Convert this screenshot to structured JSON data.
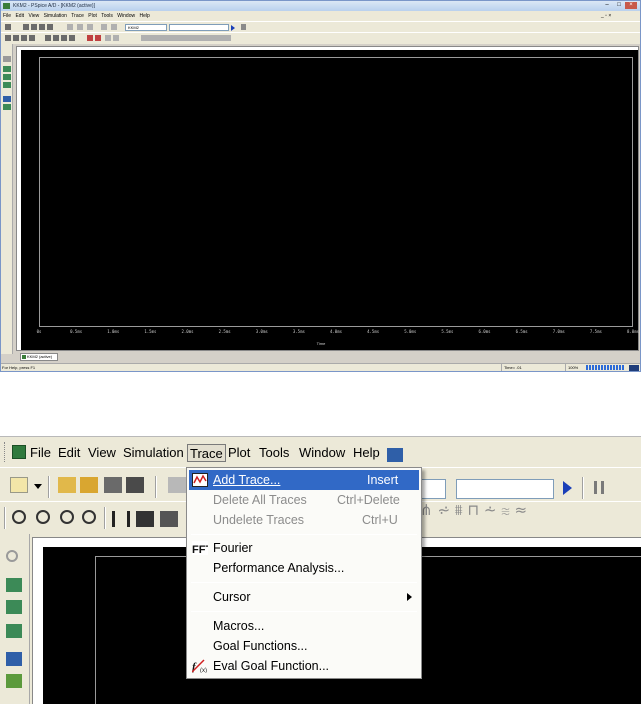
{
  "window": {
    "title": "KKM2 - PSpice A/D - [KKM2 (active)]",
    "menu": [
      "File",
      "Edit",
      "View",
      "Simulation",
      "Trace",
      "Plot",
      "Tools",
      "Window",
      "Help"
    ],
    "profile_box": "KKM2",
    "doc_tab": "KKM2 (active)",
    "status_help": "For Help, press F1",
    "status_time": "Time= .01",
    "status_percent": "100%"
  },
  "plot": {
    "x_ticks": [
      "0s",
      "0.5ms",
      "1.0ms",
      "1.5ms",
      "2.0ms",
      "2.5ms",
      "3.0ms",
      "3.5ms",
      "4.0ms",
      "4.5ms",
      "5.0ms",
      "5.5ms",
      "6.0ms",
      "6.5ms",
      "7.0ms",
      "7.5ms",
      "8.0ms"
    ],
    "x_label": "Time",
    "background": "#000000",
    "frame_color": "#9a9a9a"
  },
  "zoom_menu": {
    "file": "File",
    "edit": "Edit",
    "view": "View",
    "simulation": "Simulation",
    "trace": "Trace",
    "plot": "Plot",
    "tools": "Tools",
    "window": "Window",
    "help": "Help"
  },
  "trace_menu": {
    "add_trace": {
      "label": "Add Trace...",
      "shortcut": "Insert",
      "icon": "add-trace-icon"
    },
    "delete_all": {
      "label": "Delete All Traces",
      "shortcut": "Ctrl+Delete"
    },
    "undelete": {
      "label": "Undelete Traces",
      "shortcut": "Ctrl+U"
    },
    "fourier": {
      "label": "Fourier",
      "icon": "fft-icon"
    },
    "performance": {
      "label": "Performance Analysis..."
    },
    "cursor": {
      "label": "Cursor"
    },
    "macros": {
      "label": "Macros..."
    },
    "goal_functions": {
      "label": "Goal Functions..."
    },
    "eval_goal": {
      "label": "Eval Goal Function...",
      "icon": "eval-goal-icon"
    }
  },
  "colors": {
    "highlight": "#3169c6",
    "toolbar": "#ece9d8",
    "disabled_text": "#8c8c8c"
  }
}
